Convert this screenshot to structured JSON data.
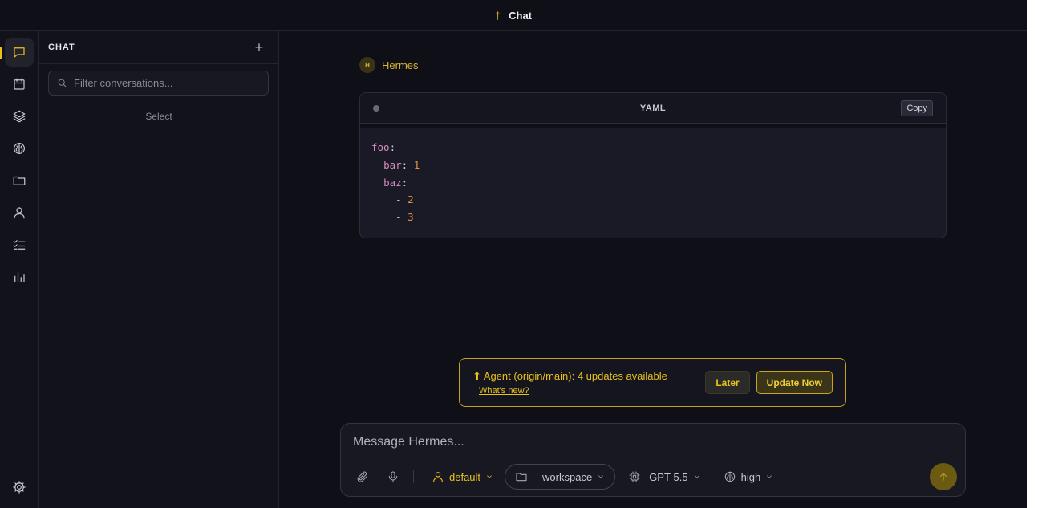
{
  "topbar": {
    "glyph": "†",
    "title": "Chat"
  },
  "rail": {
    "items": [
      {
        "icon": "chat-icon",
        "active": true
      },
      {
        "icon": "calendar-icon"
      },
      {
        "icon": "layers-icon"
      },
      {
        "icon": "brain-icon"
      },
      {
        "icon": "folder-icon"
      },
      {
        "icon": "user-icon"
      },
      {
        "icon": "checklist-icon"
      },
      {
        "icon": "bar-chart-icon"
      }
    ],
    "settings_icon": "gear-icon"
  },
  "sidebar": {
    "label": "CHAT",
    "add_label": "+",
    "filter_placeholder": "Filter conversations...",
    "select_hint": "Select"
  },
  "message": {
    "avatar_initial": "H",
    "sender": "Hermes",
    "code": {
      "language": "YAML",
      "copy_label": "Copy",
      "lines": [
        {
          "key": "foo",
          "sep": ":"
        },
        {
          "indent": "  ",
          "key": "bar",
          "sep": ": ",
          "value": "1"
        },
        {
          "indent": "  ",
          "key": "baz",
          "sep": ":"
        },
        {
          "indent": "    ",
          "dash": "- ",
          "value": "2"
        },
        {
          "indent": "    ",
          "dash": "- ",
          "value": "3"
        }
      ]
    }
  },
  "update_toast": {
    "text": "⬆ Agent (origin/main): 4 updates available",
    "link": "What's new?",
    "later_label": "Later",
    "update_label": "Update Now",
    "accent": "#e8c21a"
  },
  "composer": {
    "placeholder": "Message Hermes...",
    "profile": "default",
    "workspace": "workspace",
    "model": "GPT-5.5",
    "effort": "high"
  }
}
